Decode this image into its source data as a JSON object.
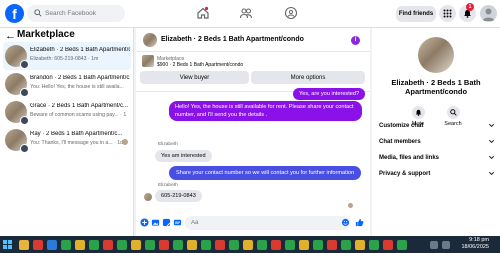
{
  "topbar": {
    "logo": "f",
    "search_placeholder": "Search Facebook",
    "find_friends": "Find friends",
    "notification_count": "1"
  },
  "marketplace": {
    "title": "Marketplace",
    "conversations": [
      {
        "title": "Elizabeth · 2 Beds 1 Bath Apartment/condo",
        "snippet": "Elizabeth: 605-219-0843 · 1m",
        "active": true
      },
      {
        "title": "Brandon · 2 Beds 1 Bath Apartment/c...",
        "snippet": "You: Hello! Yes, the house is still availa... · 1h",
        "active": false
      },
      {
        "title": "Grace · 2 Beds 1 Bath Apartment/c...",
        "snippet": "Beware of common scams using pay... · 1h",
        "active": false
      },
      {
        "title": "Ray · 2 Beds 1 Bath Apartment/c...",
        "snippet": "You: Thanks, I'll message you in a... · 1d",
        "active": false
      }
    ]
  },
  "chat": {
    "header_title": "Elizabeth · 2 Beds 1 Bath Apartment/condo",
    "listing_source": "Marketplace",
    "listing_price": "$900 · 2 Beds 1 Bath Apartment/condo",
    "view_buyer": "View buyer",
    "more_options": "More options",
    "messages": {
      "out1": "Yes, are you interested?",
      "out2": "Hello! Yes, the house is still available for rent. Please share your contact number, and I'll send you the details .",
      "sender1": "Elizabeth",
      "in1": "Yes am interested",
      "out3": "Share your contact number so we will contact you for further information",
      "sender2": "Elizabeth",
      "in2": "605-219-0843"
    },
    "composer_placeholder": "Aa"
  },
  "details": {
    "title": "Elizabeth · 2 Beds 1 Bath Apartment/condo",
    "mute": "Mute",
    "search": "Search",
    "sections": [
      "Customize chat",
      "Chat members",
      "Media, files and links",
      "Privacy & support"
    ]
  },
  "taskbar": {
    "time": "9:18 pm",
    "date": "18/06/2025"
  }
}
